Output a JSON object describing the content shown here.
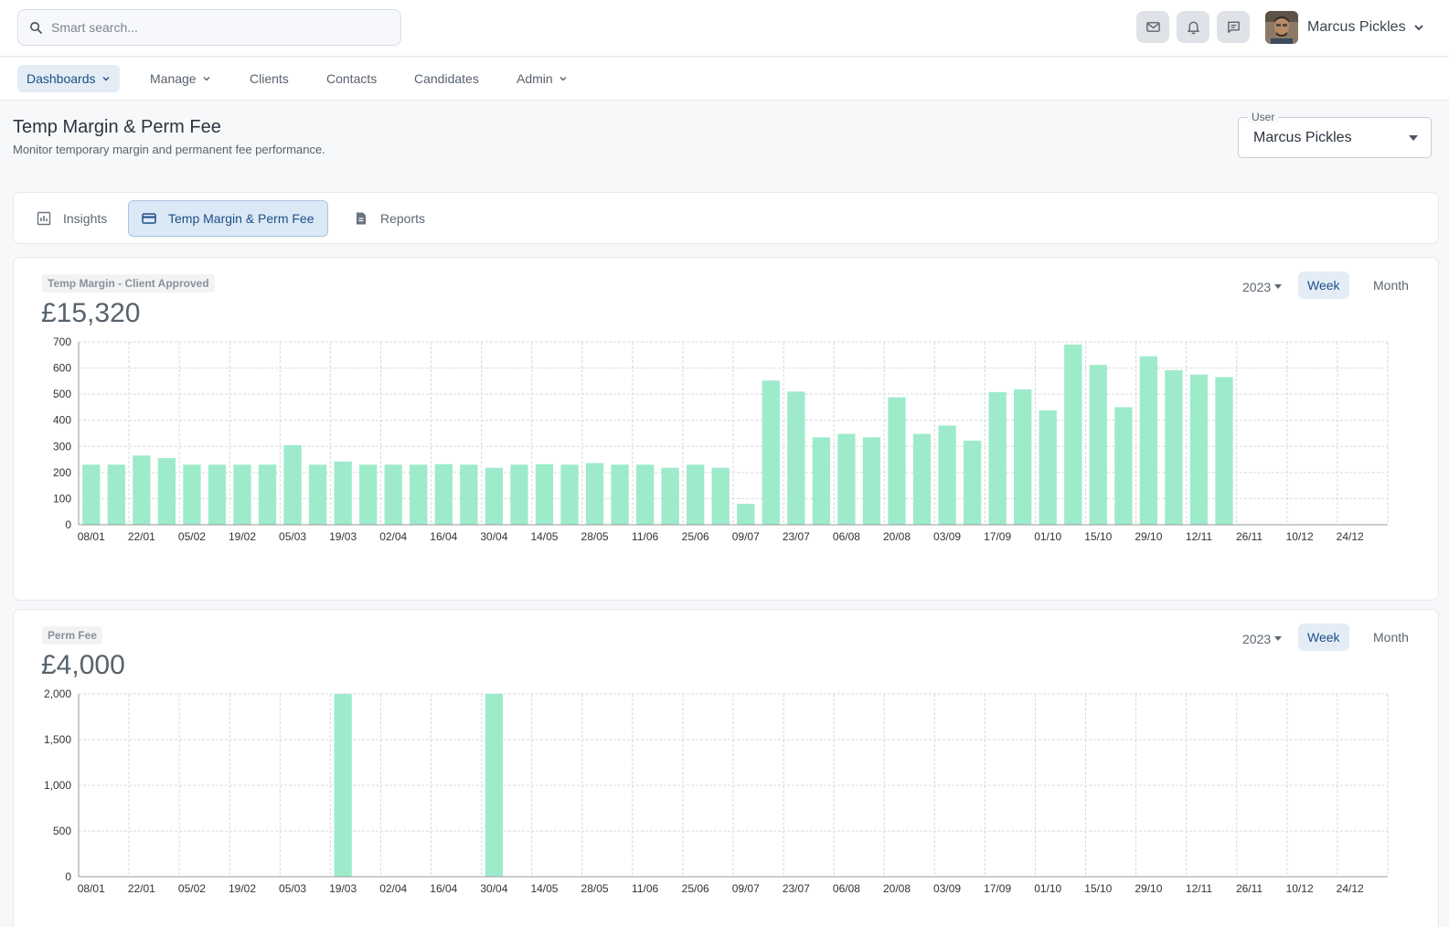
{
  "search": {
    "placeholder": "Smart search..."
  },
  "header": {
    "icons": [
      "mail-icon",
      "bell-icon",
      "chat-icon"
    ],
    "user_name": "Marcus Pickles"
  },
  "nav": {
    "items": [
      {
        "label": "Dashboards",
        "dropdown": true,
        "active": true
      },
      {
        "label": "Manage",
        "dropdown": true,
        "active": false
      },
      {
        "label": "Clients",
        "dropdown": false,
        "active": false
      },
      {
        "label": "Contacts",
        "dropdown": false,
        "active": false
      },
      {
        "label": "Candidates",
        "dropdown": false,
        "active": false
      },
      {
        "label": "Admin",
        "dropdown": true,
        "active": false
      }
    ]
  },
  "page": {
    "title": "Temp Margin & Perm Fee",
    "subtitle": "Monitor temporary margin and permanent fee performance.",
    "user_select": {
      "label": "User",
      "value": "Marcus Pickles"
    }
  },
  "tabs": [
    {
      "label": "Insights",
      "icon": "chart-icon",
      "active": false
    },
    {
      "label": "Temp Margin & Perm Fee",
      "icon": "card-icon",
      "active": true
    },
    {
      "label": "Reports",
      "icon": "document-icon",
      "active": false
    }
  ],
  "colors": {
    "accent": "#1d4f86",
    "bar": "#9debcb",
    "grid": "#d6d9dd"
  },
  "chart_data": [
    {
      "type": "bar",
      "title": "Temp Margin - Client Approved",
      "total": "£15,320",
      "year": "2023",
      "period_options": [
        "Week",
        "Month"
      ],
      "active_period": "Week",
      "ylim": [
        0,
        700
      ],
      "yticks": [
        0,
        100,
        200,
        300,
        400,
        500,
        600,
        700
      ],
      "ytick_labels": [
        "0",
        "100",
        "200",
        "300",
        "400",
        "500",
        "600",
        "700"
      ],
      "xtick_labels": [
        "08/01",
        "22/01",
        "05/02",
        "19/02",
        "05/03",
        "19/03",
        "02/04",
        "16/04",
        "30/04",
        "14/05",
        "28/05",
        "11/06",
        "25/06",
        "09/07",
        "23/07",
        "06/08",
        "20/08",
        "03/09",
        "17/09",
        "01/10",
        "15/10",
        "29/10",
        "12/11",
        "26/11",
        "10/12",
        "24/12"
      ],
      "values": [
        230,
        230,
        265,
        255,
        230,
        230,
        230,
        230,
        305,
        230,
        242,
        230,
        230,
        230,
        232,
        230,
        218,
        230,
        232,
        230,
        236,
        230,
        230,
        218,
        230,
        218,
        80,
        552,
        510,
        335,
        348,
        335,
        488,
        348,
        380,
        322,
        508,
        518,
        438,
        690,
        612,
        450,
        645,
        592,
        575,
        565,
        0,
        0,
        0,
        0,
        0,
        0
      ]
    },
    {
      "type": "bar",
      "title": "Perm Fee",
      "total": "£4,000",
      "year": "2023",
      "period_options": [
        "Week",
        "Month"
      ],
      "active_period": "Week",
      "ylim": [
        0,
        2000
      ],
      "yticks": [
        0,
        500,
        1000,
        1500,
        2000
      ],
      "ytick_labels": [
        "0",
        "500",
        "1,000",
        "1,500",
        "2,000"
      ],
      "xtick_labels": [
        "08/01",
        "22/01",
        "05/02",
        "19/02",
        "05/03",
        "19/03",
        "02/04",
        "16/04",
        "30/04",
        "14/05",
        "28/05",
        "11/06",
        "25/06",
        "09/07",
        "23/07",
        "06/08",
        "20/08",
        "03/09",
        "17/09",
        "01/10",
        "15/10",
        "29/10",
        "12/11",
        "26/11",
        "10/12",
        "24/12"
      ],
      "values": [
        0,
        0,
        0,
        0,
        0,
        0,
        0,
        0,
        0,
        0,
        2000,
        0,
        0,
        0,
        0,
        0,
        2000,
        0,
        0,
        0,
        0,
        0,
        0,
        0,
        0,
        0,
        0,
        0,
        0,
        0,
        0,
        0,
        0,
        0,
        0,
        0,
        0,
        0,
        0,
        0,
        0,
        0,
        0,
        0,
        0,
        0,
        0,
        0,
        0,
        0,
        0,
        0
      ]
    }
  ]
}
